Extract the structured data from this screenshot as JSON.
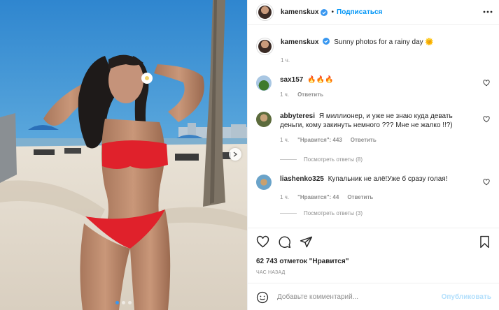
{
  "post": {
    "username": "kamenskux",
    "follow_label": "Подписаться",
    "caption": "Sunny photos for a rainy day",
    "caption_emoji": "🌞",
    "caption_time": "1 ч.",
    "likes": "62 743 отметок \"Нравится\"",
    "posted_ago": "ЧАС НАЗАД",
    "carousel": {
      "count": 3,
      "active": 1
    }
  },
  "comments": [
    {
      "username": "sax157",
      "text": "🔥🔥🔥",
      "time": "1 ч.",
      "reply_label": "Ответить",
      "likes": "",
      "replies": ""
    },
    {
      "username": "abbyteresi",
      "text": "Я миллионер, и уже не знаю куда девать деньги, кому закинуть немного ??? Мне не жалко !!?)",
      "time": "1 ч.",
      "likes": "\"Нравится\": 443",
      "reply_label": "Ответить",
      "replies": "Посмотреть ответы (8)"
    },
    {
      "username": "liashenko325",
      "text": "Купальник не алё!Уже б сразу голая!",
      "time": "1 ч.",
      "likes": "\"Нравится\": 44",
      "reply_label": "Ответить",
      "replies": "Посмотреть ответы (3)"
    }
  ],
  "composer": {
    "placeholder": "Добавьте комментарий...",
    "publish_label": "Опубликовать"
  },
  "colors": {
    "accent": "#0095f6",
    "text": "#262626",
    "muted": "#8e8e8e",
    "publish_disabled": "#b2dffc"
  }
}
